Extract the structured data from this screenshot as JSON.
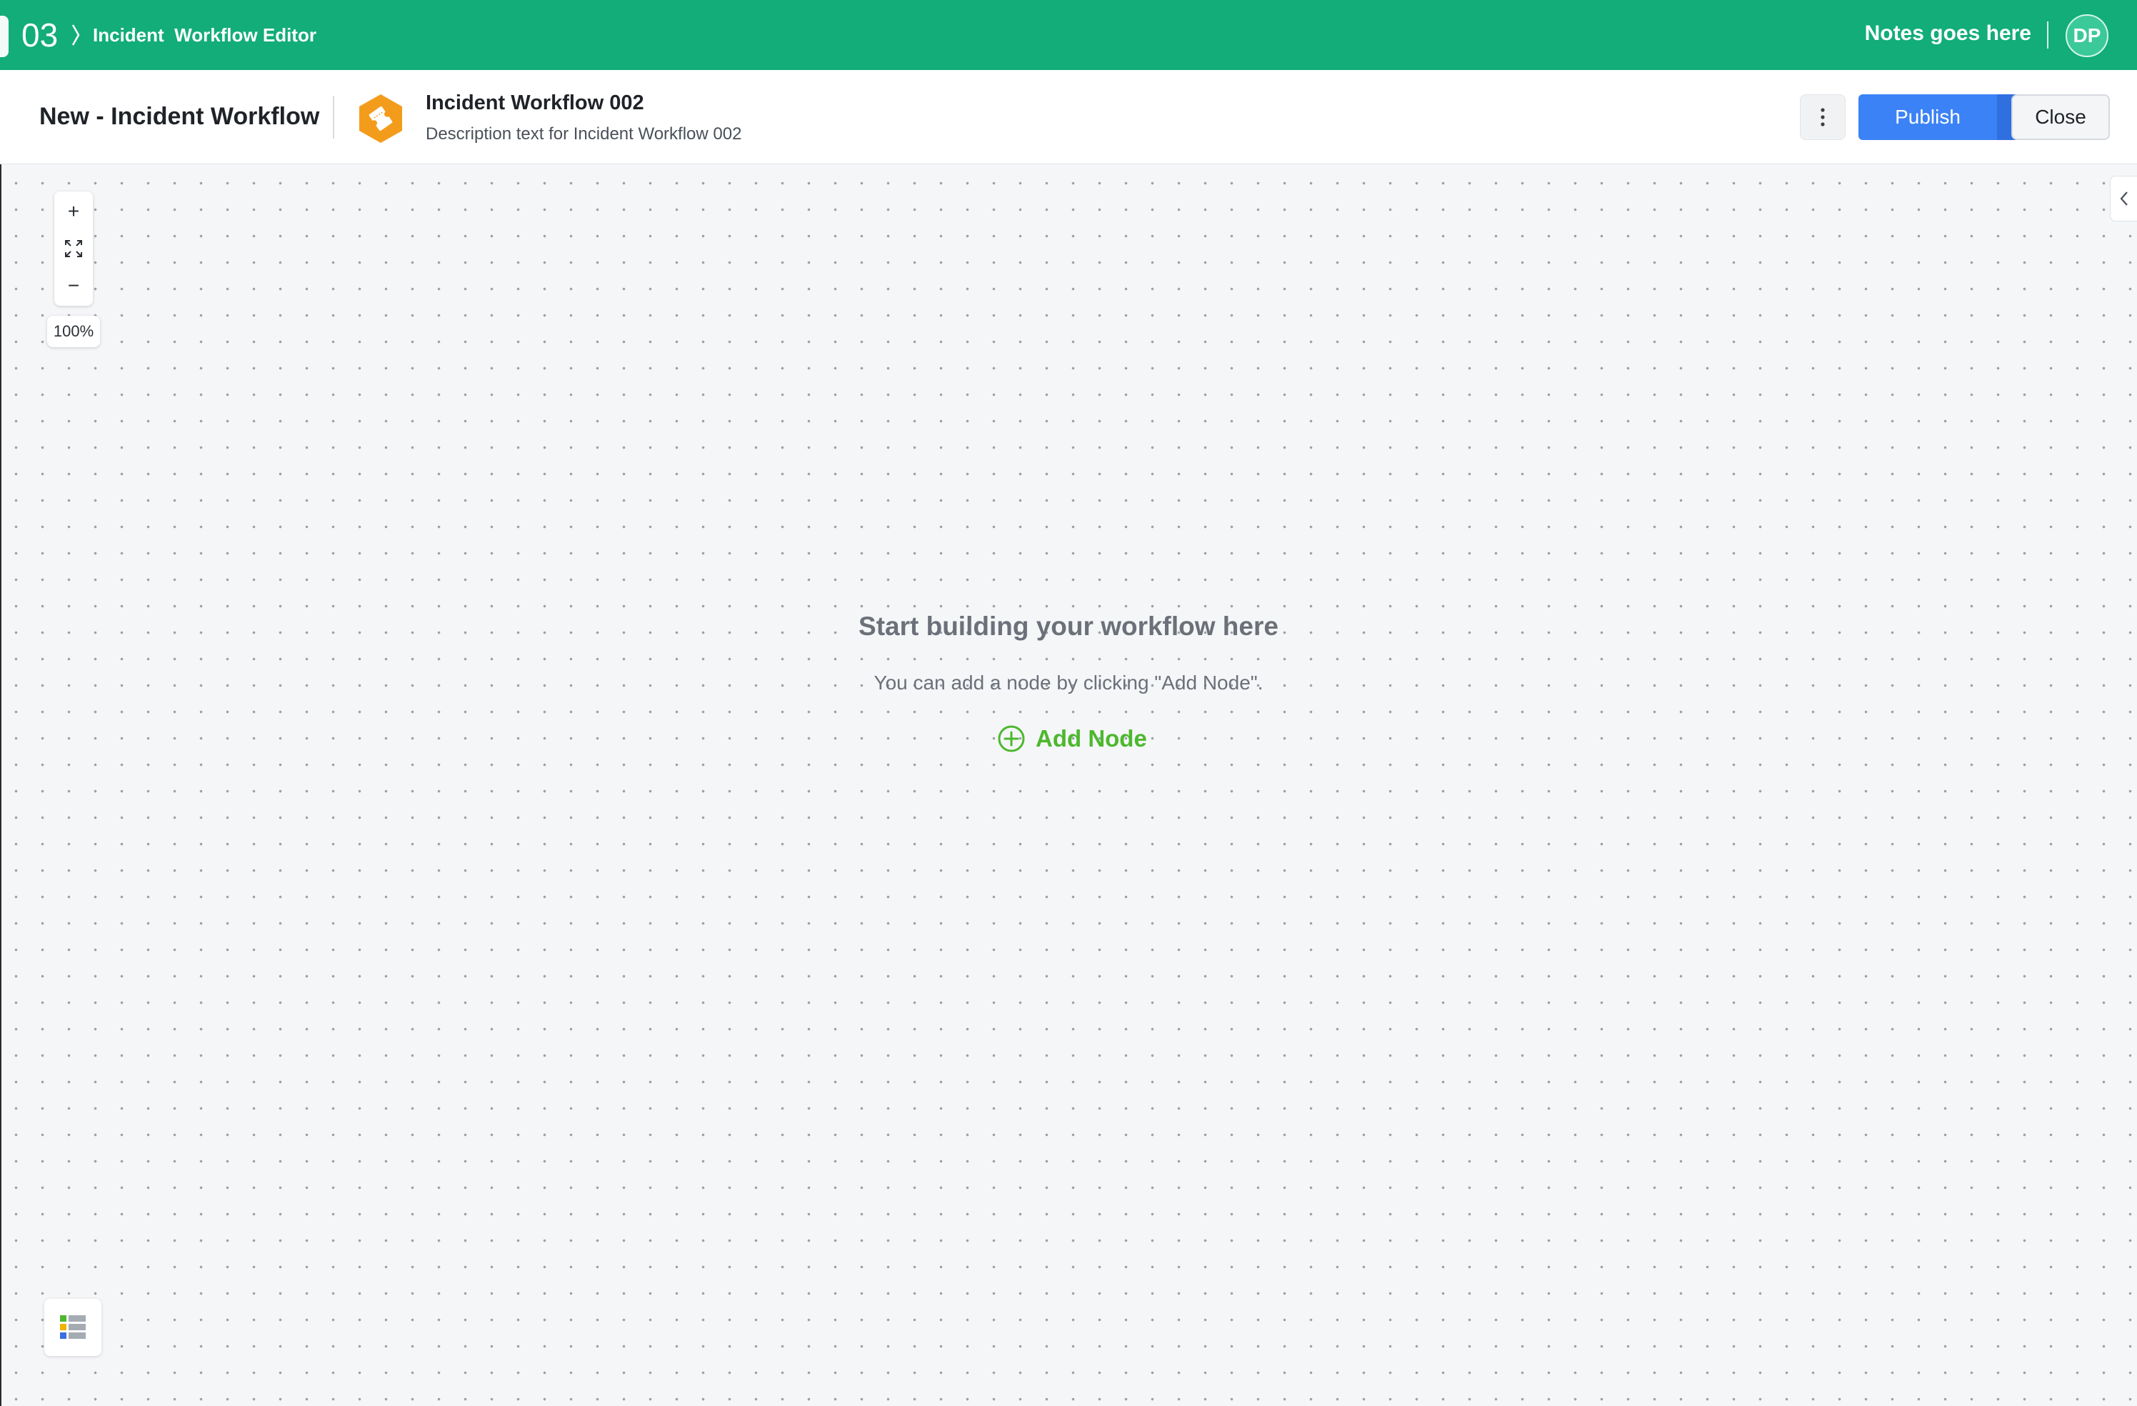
{
  "topbar": {
    "step": "03",
    "breadcrumb": "Incident  Workflow Editor",
    "notes": "Notes goes here",
    "avatar_initials": "DP",
    "color": "#12ad78"
  },
  "header": {
    "page_title": "New - Incident Workflow",
    "workflow_icon": "ticket-hexagon-icon",
    "workflow_name": "Incident Workflow 002",
    "workflow_description": "Description text for Incident Workflow 002",
    "more_icon": "vertical-ellipsis-icon",
    "publish_label": "Publish",
    "publish_color": "#3b82f6",
    "close_label": "Close"
  },
  "canvas": {
    "zoom_in": "+",
    "zoom_out": "−",
    "fit_icon": "fit-to-screen-icon",
    "zoom_level": "100%",
    "empty_title": "Start building your workflow here",
    "empty_subtitle": "You can add a node by clicking \"Add Node\".",
    "add_node_label": "Add Node",
    "accent": "#4cb82d",
    "panel_toggle_icon": "chevron-left-icon",
    "legend_icon": "legend-list-icon"
  }
}
